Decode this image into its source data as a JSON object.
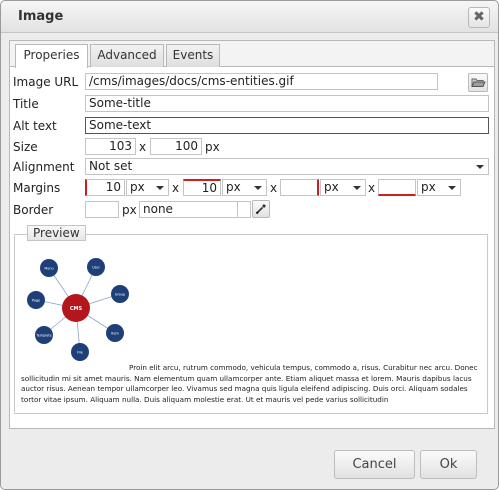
{
  "dialog": {
    "title": "Image",
    "close_glyph": "✖"
  },
  "tabs": [
    {
      "label": "Properies",
      "active": true
    },
    {
      "label": "Advanced",
      "active": false
    },
    {
      "label": "Events",
      "active": false
    }
  ],
  "form": {
    "image_url": {
      "label": "Image URL",
      "value": "/cms/images/docs/cms-entities.gif"
    },
    "title": {
      "label": "Title",
      "value": "Some-title"
    },
    "alt": {
      "label": "Alt text",
      "value": "Some-text"
    },
    "size": {
      "label": "Size",
      "width": "103",
      "height": "100",
      "times": "x",
      "unit": "px"
    },
    "alignment": {
      "label": "Alignment",
      "value": "Not set"
    },
    "margins": {
      "label": "Margins",
      "top": "10",
      "right": "10",
      "bottom": "",
      "left": "",
      "unit": "px",
      "times": "x"
    },
    "border": {
      "label": "Border",
      "width": "",
      "unit": "px",
      "style": "none"
    }
  },
  "preview": {
    "legend": "Preview",
    "diagram": {
      "center": "CMS",
      "nodes": [
        "Menu",
        "User",
        "Group",
        "Item",
        "File",
        "Template",
        "Page"
      ]
    },
    "text": "Proin elit arcu, rutrum commodo, vehicula tempus, commodo a, risus. Curabitur nec arcu. Donec sollicitudin mi sit amet mauris. Nam elementum quam ullamcorper ante. Etiam aliquet massa et lorem. Mauris dapibus lacus auctor risus. Aenean tempor ullamcorper leo. Vivamus sed magna quis ligula eleifend adipiscing. Duis orci. Aliquam sodales tortor vitae ipsum. Aliquam nulla. Duis aliquam molestie erat. Ut et mauris vel pede varius sollicitudin"
  },
  "buttons": {
    "cancel": "Cancel",
    "ok": "Ok"
  },
  "colors": {
    "node_blue": "#1f3f78",
    "center_red": "#b3161c",
    "invalid_red": "#cc1f1f"
  },
  "icons": [
    "close-icon",
    "folder-browse-icon",
    "color-picker-icon",
    "chevron-down-icon"
  ]
}
